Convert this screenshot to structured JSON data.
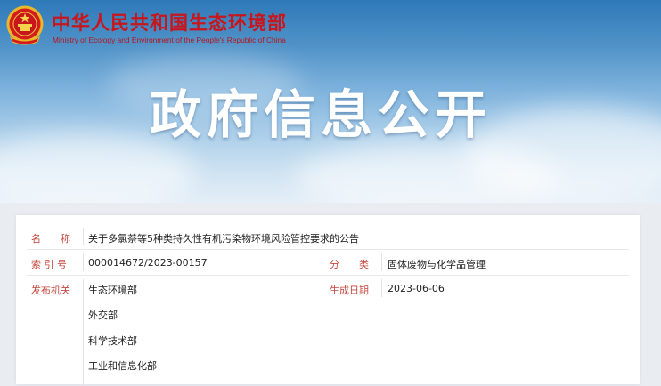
{
  "header": {
    "org_name": "中华人民共和国生态环境部",
    "org_name_en": "Ministry of Ecology and Environment of the People's Republic of China",
    "emblem_icon": "national-emblem-icon"
  },
  "hero": {
    "title": "政府信息公开"
  },
  "info": {
    "title_label": "名　　称",
    "title_value": "关于多氯萘等5种类持久性有机污染物环境风险管控要求的公告",
    "index_label": "索 引 号",
    "index_value": "000014672/2023-00157",
    "category_label": "分　　类",
    "category_value": "固体废物与化学品管理",
    "issuer_label": "发布机关",
    "issuers": [
      "生态环境部",
      "外交部",
      "科学技术部",
      "工业和信息化部"
    ],
    "date_label": "生成日期",
    "date_value": "2023-06-06"
  },
  "colors": {
    "brand_red": "#c8161d",
    "label_red": "#c4483f"
  }
}
